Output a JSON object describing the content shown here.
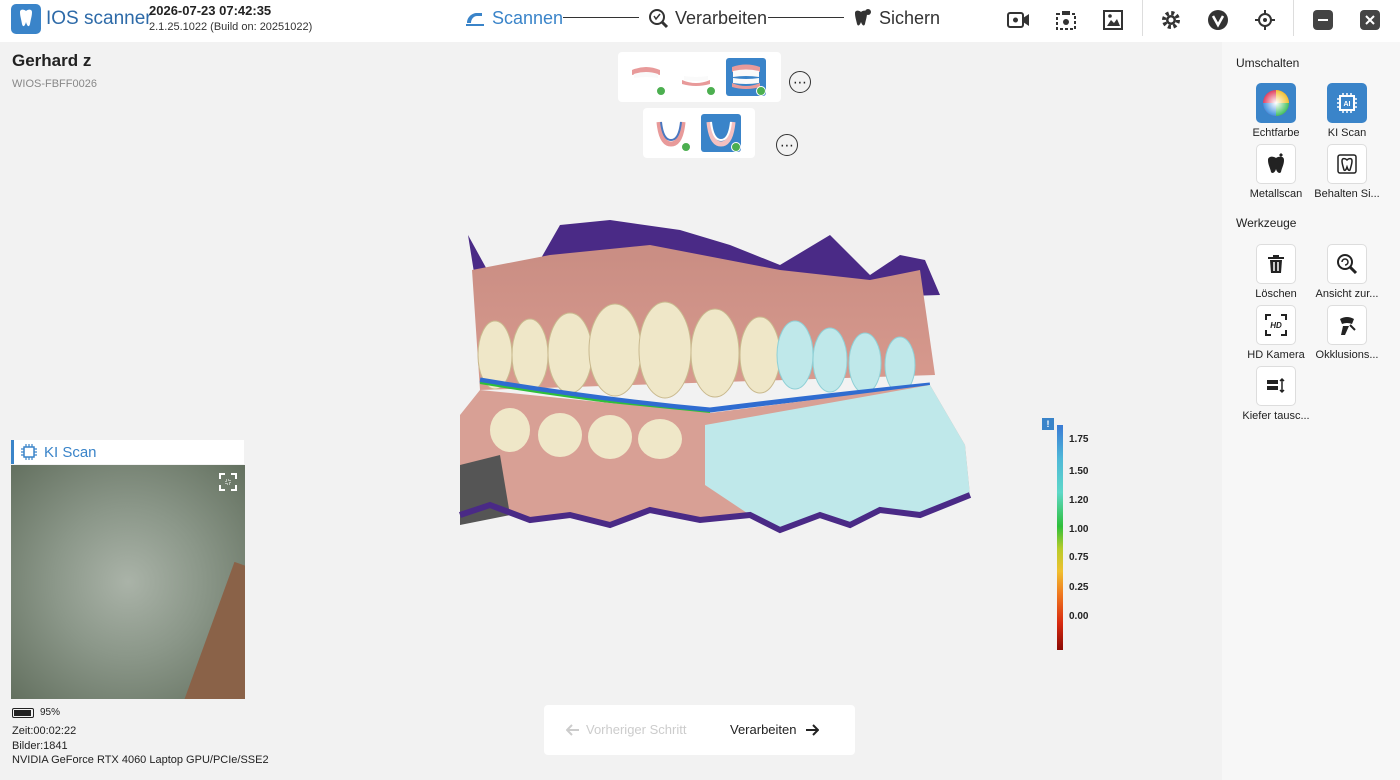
{
  "header": {
    "app_title": "IOS scanner",
    "datetime": "2026-07-23 07:42:35",
    "version": "2.1.25.1022 (Build on: 20251022)",
    "steps": [
      {
        "label": "Scannen",
        "active": true
      },
      {
        "label": "Verarbeiten",
        "active": false
      },
      {
        "label": "Sichern",
        "active": false
      }
    ],
    "icons": [
      "video-record-icon",
      "screenshot-icon",
      "gallery-icon",
      "settings-icon",
      "vendor-logo-icon",
      "target-icon",
      "minimize-icon",
      "close-icon"
    ]
  },
  "patient": {
    "name": "Gerhard z",
    "id": "WIOS-FBFF0026"
  },
  "legend": {
    "values": [
      "1.75",
      "1.50",
      "1.20",
      "1.00",
      "0.75",
      "0.25",
      "0.00"
    ],
    "info": "!"
  },
  "right_panel": {
    "switch_title": "Umschalten",
    "switch_items": [
      {
        "label": "Echtfarbe",
        "icon": "color-wheel-icon",
        "active": true
      },
      {
        "label": "KI Scan",
        "icon": "ai-chip-icon",
        "active": true
      },
      {
        "label": "Metallscan",
        "icon": "metal-tooth-icon",
        "active": false
      },
      {
        "label": "Behalten Si...",
        "icon": "keep-tooth-icon",
        "active": false
      }
    ],
    "tools_title": "Werkzeuge",
    "tool_items": [
      {
        "label": "Löschen",
        "icon": "trash-icon"
      },
      {
        "label": "Ansicht zur...",
        "icon": "zoom-reset-icon"
      },
      {
        "label": "HD Kamera",
        "icon": "hd-camera-icon"
      },
      {
        "label": "Okklusions...",
        "icon": "occlusion-icon"
      },
      {
        "label": "Kiefer tausc...",
        "icon": "swap-jaw-icon"
      }
    ]
  },
  "preview": {
    "title": "KI Scan",
    "battery": "95%",
    "battery_level": 0.95,
    "time": "Zeit:00:02:22",
    "images": "Bilder:1841",
    "gpu": "NVIDIA GeForce RTX 4060 Laptop GPU/PCIe/SSE2"
  },
  "bottom_nav": {
    "prev_label": "Vorheriger Schritt",
    "next_label": "Verarbeiten"
  },
  "colors": {
    "accent": "#3a84c9",
    "check": "#4caf50"
  }
}
